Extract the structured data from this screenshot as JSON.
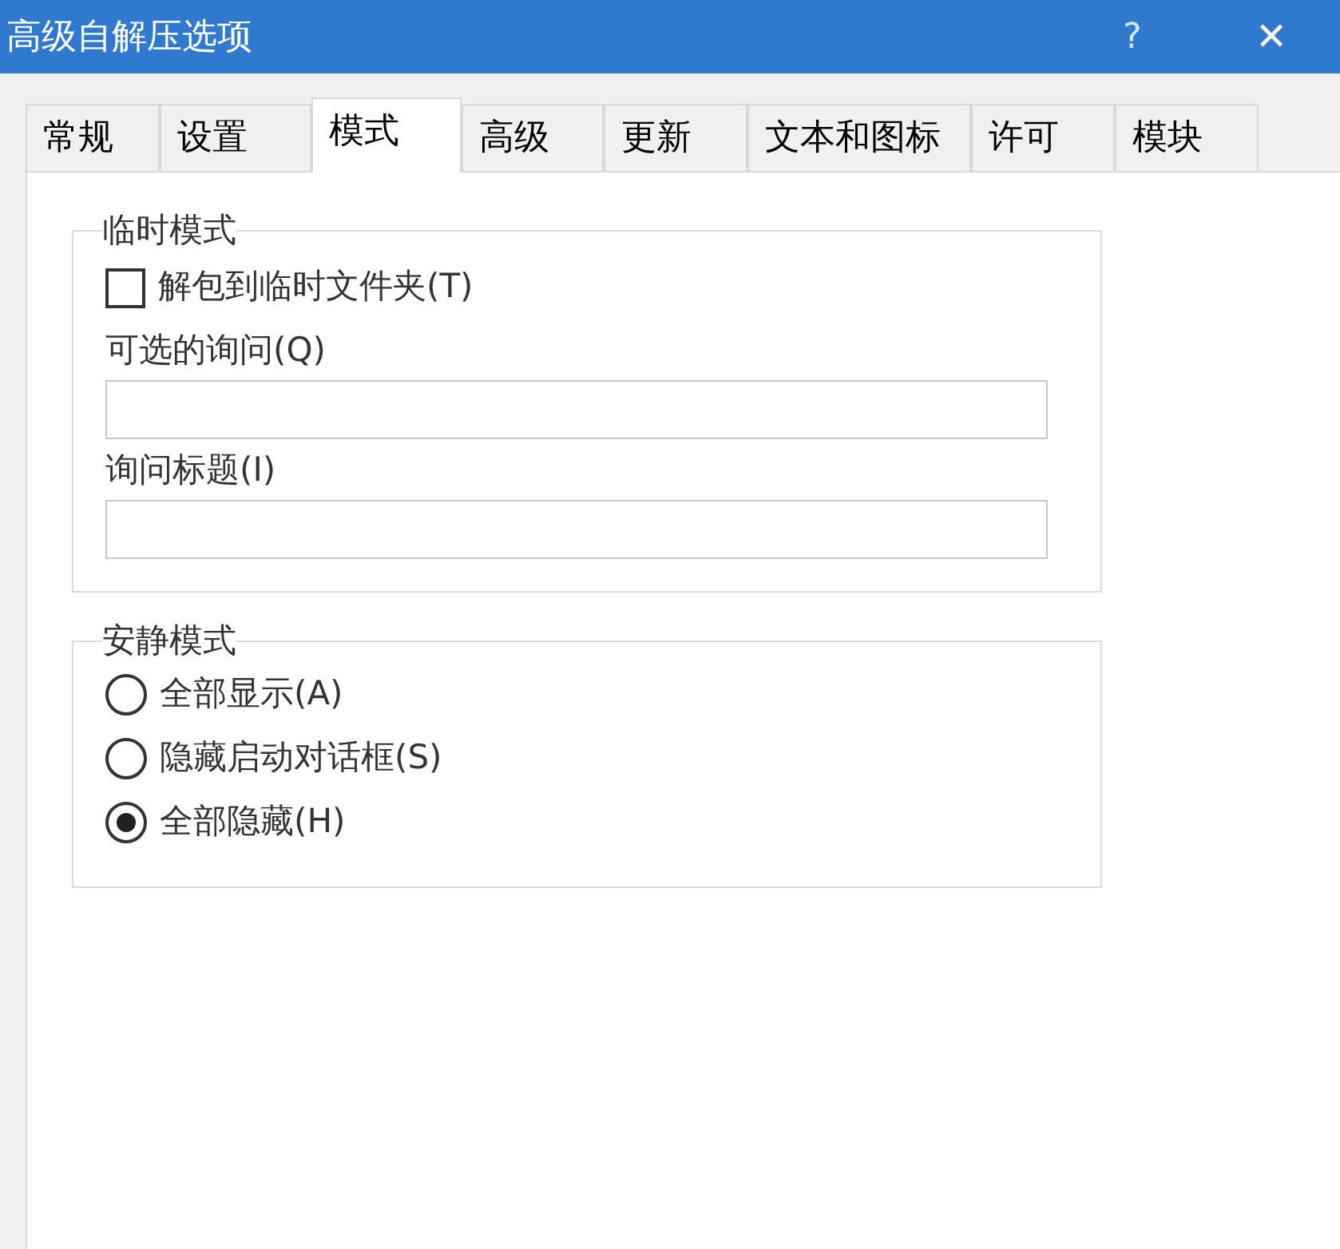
{
  "window": {
    "title": "高级自解压选项",
    "help": "?",
    "close": "✕"
  },
  "tabs": [
    {
      "label": "常规",
      "selected": false
    },
    {
      "label": "设置",
      "selected": false
    },
    {
      "label": "模式",
      "selected": true
    },
    {
      "label": "高级",
      "selected": false
    },
    {
      "label": "更新",
      "selected": false
    },
    {
      "label": "文本和图标",
      "selected": false
    },
    {
      "label": "许可",
      "selected": false
    },
    {
      "label": "模块",
      "selected": false
    }
  ],
  "groups": [
    {
      "title": "临时模式",
      "items": [
        {
          "kind": "checkbox",
          "label": "解包到临时文件夹(T)",
          "checked": false
        },
        {
          "kind": "field",
          "label": "可选的询问(Q)"
        },
        {
          "kind": "field",
          "label": "询问标题(I)"
        }
      ]
    },
    {
      "title": "安静模式",
      "items": [
        {
          "kind": "radio",
          "label": "全部显示(A)",
          "selected": false
        },
        {
          "kind": "radio",
          "label": "隐藏启动对话框(S)",
          "selected": false
        },
        {
          "kind": "radio",
          "label": "全部隐藏(H)",
          "selected": true
        }
      ]
    }
  ]
}
